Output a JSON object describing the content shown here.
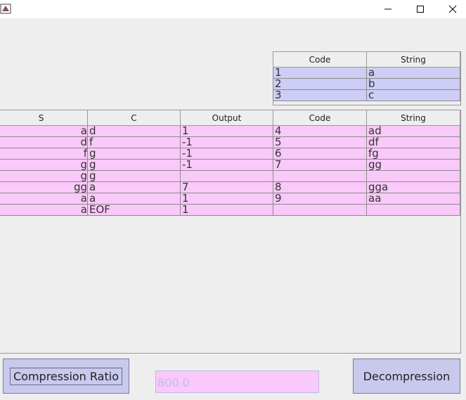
{
  "window": {
    "controls": {
      "minimize": "–",
      "maximize": "□",
      "close": "✕"
    }
  },
  "dictionary": {
    "headers": [
      "Code",
      "String"
    ],
    "rows": [
      [
        "1",
        "a"
      ],
      [
        "2",
        "b"
      ],
      [
        "3",
        "c"
      ]
    ]
  },
  "output_table": {
    "headers": [
      "S",
      "C",
      "Output",
      "Code",
      "String"
    ],
    "rows": [
      [
        "a",
        "d",
        "1",
        "4",
        "ad"
      ],
      [
        "d",
        "f",
        "-1",
        "5",
        "df"
      ],
      [
        "f",
        "g",
        "-1",
        "6",
        "fg"
      ],
      [
        "g",
        "g",
        "-1",
        "7",
        "gg"
      ],
      [
        "g",
        "g",
        "",
        "",
        ""
      ],
      [
        "gg",
        "a",
        "7",
        "8",
        "gga"
      ],
      [
        "a",
        "a",
        "1",
        "9",
        "aa"
      ],
      [
        "a",
        "EOF",
        "1",
        "",
        ""
      ]
    ]
  },
  "controls": {
    "compression_ratio_label": "Compression Ratio",
    "ratio_value": "800.0",
    "decompression_label": "Decompression"
  },
  "colors": {
    "dictionary_row": "#cdcdf6",
    "output_row": "#f9c9f9",
    "button": "#c9c9ee"
  }
}
